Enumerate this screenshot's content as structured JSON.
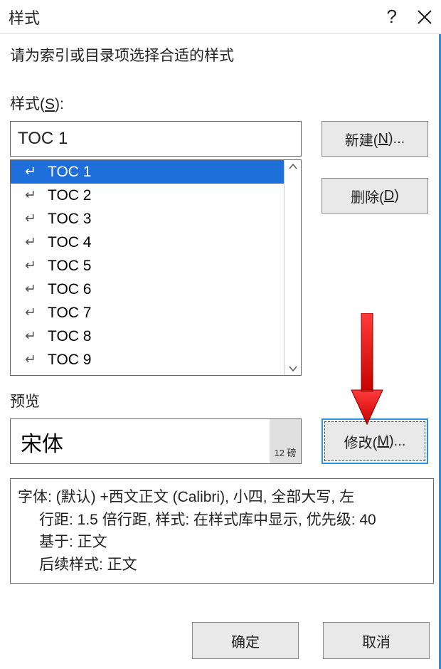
{
  "titlebar": {
    "title": "样式"
  },
  "prompt": "请为索引或目录项选择合适的样式",
  "styles": {
    "label_pre": "样式(",
    "label_u": "S",
    "label_post": "):",
    "input_value": "TOC 1",
    "items": [
      "TOC 1",
      "TOC 2",
      "TOC 3",
      "TOC 4",
      "TOC 5",
      "TOC 6",
      "TOC 7",
      "TOC 8",
      "TOC 9"
    ],
    "selected_index": 0
  },
  "buttons": {
    "new_pre": "新建(",
    "new_u": "N",
    "new_post": ")...",
    "delete_pre": "删除(",
    "delete_u": "D",
    "delete_post": ")",
    "modify_pre": "修改(",
    "modify_u": "M",
    "modify_post": ")...",
    "ok": "确定",
    "cancel": "取消"
  },
  "preview": {
    "label": "预览",
    "font_name": "宋体",
    "size_label": "12 磅"
  },
  "description": {
    "line1": "字体: (默认) +西文正文 (Calibri), 小四, 全部大写, 左",
    "line2": "行距: 1.5 倍行距, 样式: 在样式库中显示, 优先级: 40",
    "line3": "基于: 正文",
    "line4": "后续样式: 正文"
  }
}
